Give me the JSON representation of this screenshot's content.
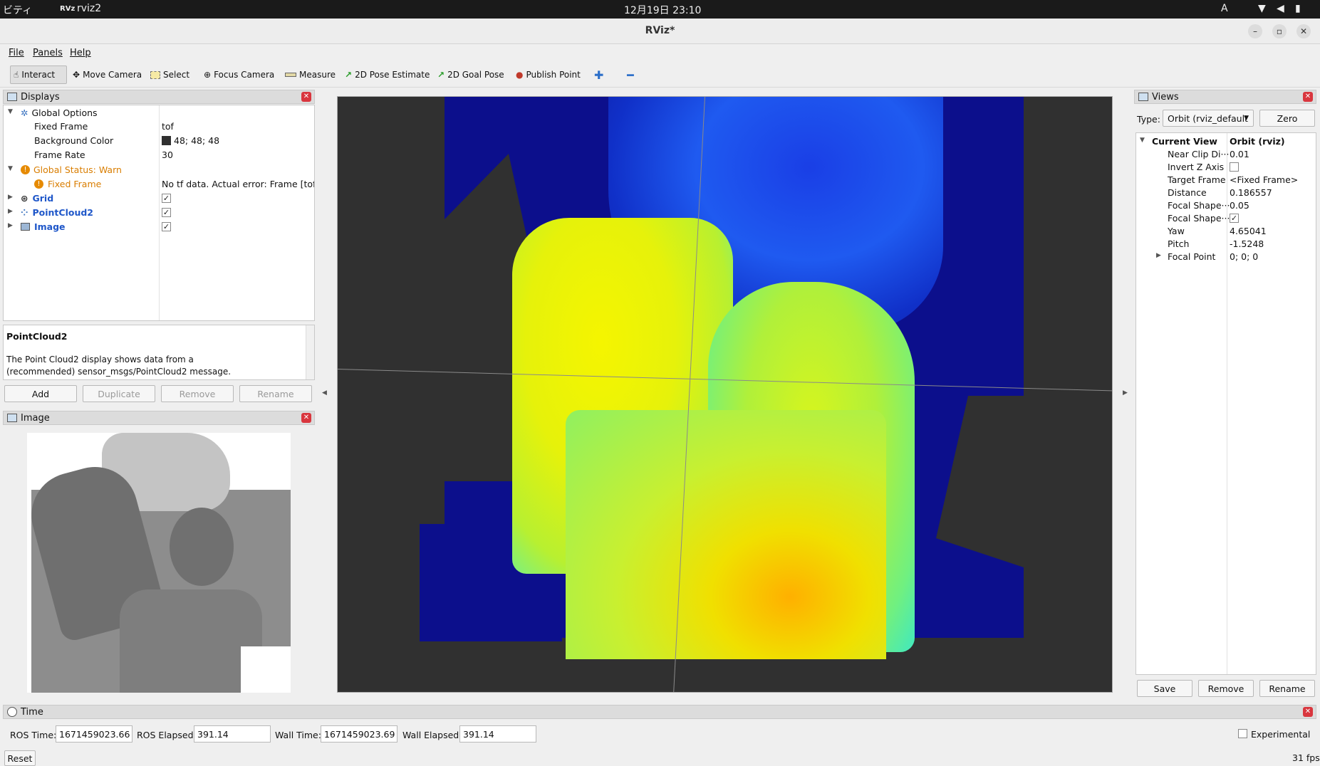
{
  "system_bar": {
    "left_text": "ビティ",
    "app_label": "rviz2",
    "clock": "12月19日 23:10",
    "input_method": "A"
  },
  "window": {
    "title": "RViz*"
  },
  "menu": {
    "file": "File",
    "panels": "Panels",
    "help": "Help"
  },
  "toolbar": {
    "interact": "Interact",
    "move_camera": "Move Camera",
    "select": "Select",
    "focus_camera": "Focus Camera",
    "measure": "Measure",
    "pose_estimate": "2D Pose Estimate",
    "goal_pose": "2D Goal Pose",
    "publish_point": "Publish Point"
  },
  "displays": {
    "title": "Displays",
    "global_options": "Global Options",
    "fixed_frame_label": "Fixed Frame",
    "fixed_frame_value": "tof",
    "bg_color_label": "Background Color",
    "bg_color_value": "48; 48; 48",
    "bg_color_hex": "#303030",
    "frame_rate_label": "Frame Rate",
    "frame_rate_value": "30",
    "global_status": "Global Status: Warn",
    "status_fixed_frame": "Fixed Frame",
    "status_fixed_frame_value": "No tf data.  Actual error: Frame [tof] ···",
    "grid": "Grid",
    "pointcloud": "PointCloud2",
    "image": "Image",
    "warn_color": "#d97d00",
    "link_color": "#1f57c9"
  },
  "description": {
    "title": "PointCloud2",
    "body": "The Point Cloud2 display shows data from a (recommended) sensor_msgs/PointCloud2 message."
  },
  "display_buttons": {
    "add": "Add",
    "duplicate": "Duplicate",
    "remove": "Remove",
    "rename": "Rename"
  },
  "image_panel": {
    "title": "Image"
  },
  "views": {
    "title": "Views",
    "type_label": "Type:",
    "type_value": "Orbit (rviz_default",
    "zero": "Zero",
    "current_view": "Current View",
    "current_view_value": "Orbit (rviz)",
    "near_clip_label": "Near Clip Di···",
    "near_clip_value": "0.01",
    "invert_z_label": "Invert Z Axis",
    "target_frame_label": "Target Frame",
    "target_frame_value": "<Fixed Frame>",
    "distance_label": "Distance",
    "distance_value": "0.186557",
    "focal_size_label": "Focal Shape···",
    "focal_size_value": "0.05",
    "focal_fixed_label": "Focal Shape···",
    "yaw_label": "Yaw",
    "yaw_value": "4.65041",
    "pitch_label": "Pitch",
    "pitch_value": "-1.5248",
    "focal_point_label": "Focal Point",
    "focal_point_value": "0; 0; 0",
    "save": "Save",
    "remove": "Remove",
    "rename": "Rename"
  },
  "time_panel": {
    "title": "Time",
    "ros_time_label": "ROS Time:",
    "ros_time": "1671459023.66",
    "ros_elapsed_label": "ROS Elapsed:",
    "ros_elapsed": "391.14",
    "wall_time_label": "Wall Time:",
    "wall_time": "1671459023.69",
    "wall_elapsed_label": "Wall Elapsed:",
    "wall_elapsed": "391.14",
    "experimental": "Experimental",
    "reset": "Reset",
    "fps": "31 fps"
  }
}
